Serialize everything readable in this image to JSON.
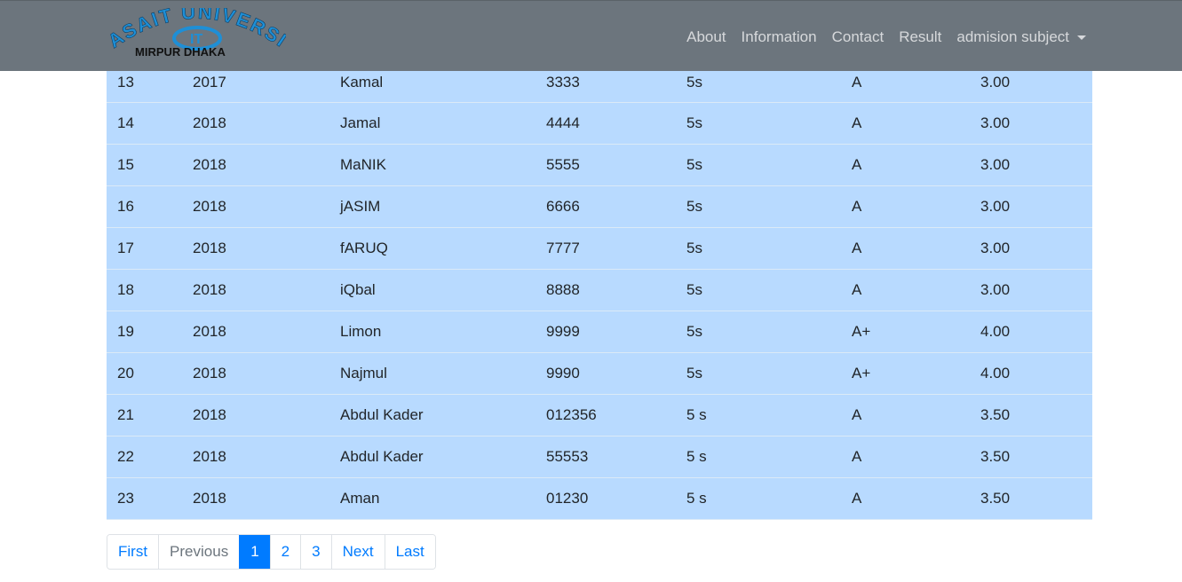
{
  "brand": {
    "arc_text": "ASAIT UNIVERSITY",
    "sub_text": "MIRPUR DHAKA",
    "mono": "IT"
  },
  "nav": {
    "about": "About",
    "information": "Information",
    "contact": "Contact",
    "result": "Result",
    "admission": "admision subject"
  },
  "rows": [
    [
      "13",
      "2017",
      "Kamal",
      "3333",
      "5s",
      "A",
      "3.00"
    ],
    [
      "14",
      "2018",
      "Jamal",
      "4444",
      "5s",
      "A",
      "3.00"
    ],
    [
      "15",
      "2018",
      "MaNIK",
      "5555",
      "5s",
      "A",
      "3.00"
    ],
    [
      "16",
      "2018",
      "jASIM",
      "6666",
      "5s",
      "A",
      "3.00"
    ],
    [
      "17",
      "2018",
      "fARUQ",
      "7777",
      "5s",
      "A",
      "3.00"
    ],
    [
      "18",
      "2018",
      "iQbal",
      "8888",
      "5s",
      "A",
      "3.00"
    ],
    [
      "19",
      "2018",
      "Limon",
      "9999",
      "5s",
      "A+",
      "4.00"
    ],
    [
      "20",
      "2018",
      "Najmul",
      "9990",
      "5s",
      "A+",
      "4.00"
    ],
    [
      "21",
      "2018",
      "Abdul Kader",
      "012356",
      "5 s",
      "A",
      "3.50"
    ],
    [
      "22",
      "2018",
      "Abdul Kader",
      "55553",
      "5 s",
      "A",
      "3.50"
    ],
    [
      "23",
      "2018",
      "Aman",
      "01230",
      "5 s",
      "A",
      "3.50"
    ]
  ],
  "pagination": {
    "first": "First",
    "previous": "Previous",
    "p1": "1",
    "p2": "2",
    "p3": "3",
    "next": "Next",
    "last": "Last"
  },
  "colors": {
    "navbar": "#6c757d",
    "row_bg": "#b8daff",
    "accent": "#007bff",
    "logo": "#1e8fd6"
  }
}
